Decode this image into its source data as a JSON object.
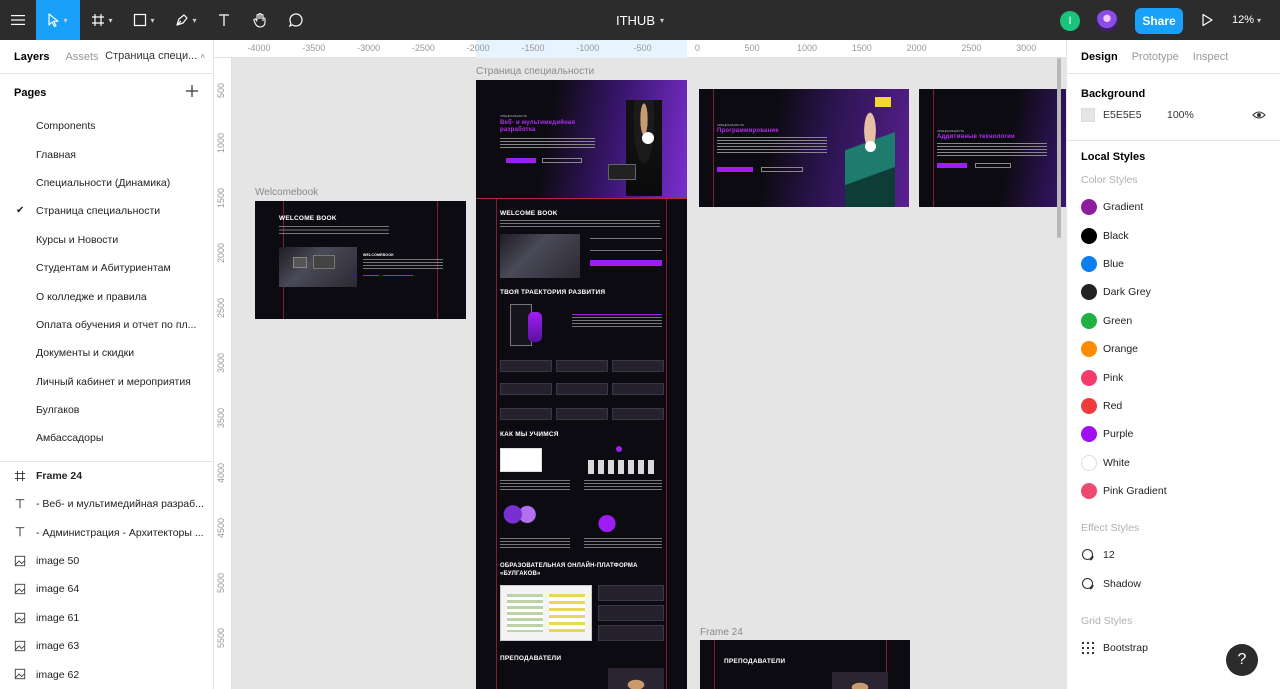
{
  "toolbar": {
    "doc_title": "ITHUB",
    "share_label": "Share",
    "zoom": "12%",
    "user_initial": "I",
    "active_color": "#18a0fb"
  },
  "left_panel": {
    "tabs": [
      "Layers",
      "Assets"
    ],
    "current_page": "Страница специ...",
    "pages_title": "Pages",
    "pages": [
      "Components",
      "Главная",
      "Специальности (Динамика)",
      "Страница специальности",
      "Курсы и Новости",
      "Студентам и Абитуриентам",
      "О колледже и правила",
      "Оплата обучения и отчет по пл...",
      "Документы и скидки",
      "Личный кабинет и мероприятия",
      "Булгаков",
      "Амбассадоры"
    ],
    "selected_page_index": 3,
    "layers": [
      {
        "type": "frame",
        "name": "Frame 24"
      },
      {
        "type": "text",
        "name": "- Веб- и мультимедийная разраб..."
      },
      {
        "type": "text",
        "name": "- Администрация - Архитекторы ..."
      },
      {
        "type": "image",
        "name": "image 50"
      },
      {
        "type": "image",
        "name": "image 64"
      },
      {
        "type": "image",
        "name": "image 61"
      },
      {
        "type": "image",
        "name": "image 63"
      },
      {
        "type": "image",
        "name": "image 62"
      }
    ]
  },
  "canvas": {
    "ruler_x": [
      "-4000",
      "-3500",
      "-3000",
      "-2500",
      "-2000",
      "-1500",
      "-1000",
      "-500",
      "0",
      "500",
      "1000",
      "1500",
      "2000",
      "2500",
      "3000"
    ],
    "ruler_y": [
      "500",
      "1000",
      "1500",
      "2000",
      "2500",
      "3000",
      "3500",
      "4000",
      "4500",
      "5000",
      "5500"
    ],
    "frames": {
      "welcomebook_label": "Welcomebook",
      "main_label": "Страница специальности",
      "frame24_label": "Frame 24"
    },
    "mock": {
      "specialty": "СПЕЦИАЛЬНОСТЬ",
      "web_title": "Веб- и мультимедийная разработка",
      "prog_title": "Программирование",
      "additive_title": "Аддитивные технологии",
      "welcome_book": "WELCOME BOOK",
      "welcomebook_small": "WELCOMEBOOK",
      "trajectory": "ТВОЯ ТРАЕКТОРИЯ РАЗВИТИЯ",
      "how_we_learn": "КАК МЫ УЧИМСЯ",
      "platform": "ОБРАЗОВАТЕЛЬНАЯ ОНЛАЙН-ПЛАТФОРМА «БУЛГАКОВ»",
      "teachers": "ПРЕПОДАВАТЕЛИ"
    }
  },
  "right_panel": {
    "tabs": [
      "Design",
      "Prototype",
      "Inspect"
    ],
    "background_title": "Background",
    "background_hex": "E5E5E5",
    "background_opacity": "100%",
    "local_styles_title": "Local Styles",
    "color_styles_title": "Color Styles",
    "color_styles": [
      {
        "name": "Gradient",
        "color": "#8e1c9e"
      },
      {
        "name": "Black",
        "color": "#000000"
      },
      {
        "name": "Blue",
        "color": "#0d7ef2"
      },
      {
        "name": "Dark Grey",
        "color": "#222222"
      },
      {
        "name": "Green",
        "color": "#1fb141"
      },
      {
        "name": "Orange",
        "color": "#ff8c00"
      },
      {
        "name": "Pink",
        "color": "#f23d6a"
      },
      {
        "name": "Red",
        "color": "#ef3b3b"
      },
      {
        "name": "Purple",
        "color": "#a110f0"
      },
      {
        "name": "White",
        "color": "#ffffff"
      },
      {
        "name": "Pink Gradient",
        "color": "#ee4a70"
      }
    ],
    "effect_styles_title": "Effect Styles",
    "effect_styles": [
      "12",
      "Shadow"
    ],
    "grid_styles_title": "Grid Styles",
    "grid_styles": [
      "Bootstrap"
    ]
  },
  "help_label": "?"
}
